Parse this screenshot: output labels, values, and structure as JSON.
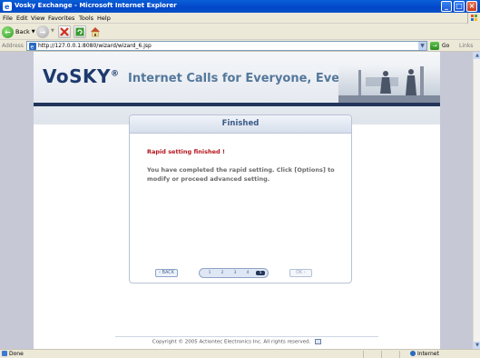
{
  "window": {
    "title": "Vosky Exchange - Microsoft Internet Explorer"
  },
  "menu": [
    "File",
    "Edit",
    "View",
    "Favorites",
    "Tools",
    "Help"
  ],
  "toolbar": {
    "back_label": "Back"
  },
  "address": {
    "label": "Address",
    "url": "http://127.0.0.1:8080/wizard/wizard_6.jsp",
    "go_label": "Go",
    "links_label": "Links"
  },
  "banner": {
    "logo": "VoSKY",
    "logo_mark": "®",
    "tagline": "Internet Calls for Everyone, Everywhere™"
  },
  "panel": {
    "title": "Finished",
    "subtitle": "Rapid setting finished !",
    "body": "You have completed the rapid setting. Click [Options] to modify or proceed advanced setting.",
    "back_button": "‹ BACK",
    "ok_button": "OK ›",
    "steps": [
      "1",
      "2",
      "3",
      "4",
      "5"
    ],
    "active_step": "5"
  },
  "footer": {
    "copyright": "Copyright © 2005 Actiontec Electronics Inc. All rights reserved."
  },
  "status": {
    "left": "Done",
    "zone": "Internet"
  },
  "colors": {
    "accent_navy": "#23355b",
    "title_blue": "#3a5a86",
    "alert_red": "#b4141b",
    "titlebar_blue": "#0246c8"
  }
}
